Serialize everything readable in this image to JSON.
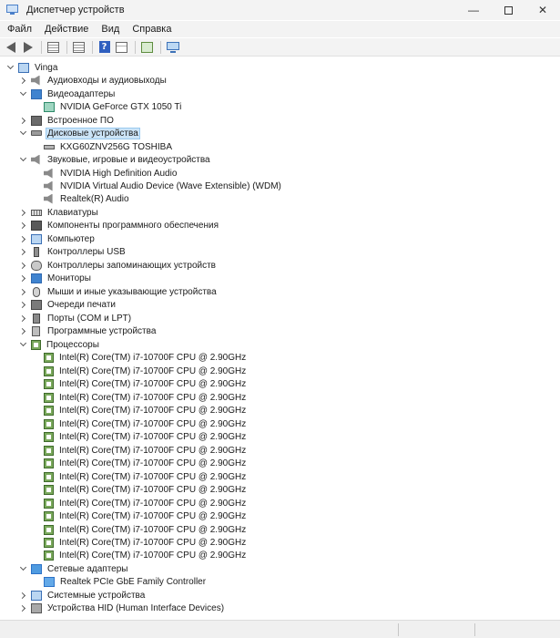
{
  "window": {
    "title": "Диспетчер устройств",
    "controls": {
      "minimize": "—",
      "maximize": "",
      "close": "✕"
    }
  },
  "menu": [
    "Файл",
    "Действие",
    "Вид",
    "Справка"
  ],
  "toolbar": {
    "buttons": [
      "back-icon",
      "forward-icon",
      "view-icon",
      "list-icon",
      "help-icon",
      "properties-icon",
      "scan-icon",
      "monitor-icon"
    ]
  },
  "tree": {
    "root": "Vinga",
    "categories": [
      {
        "label": "Аудиовходы и аудиовыходы",
        "icon": "audio-icon",
        "expanded": false
      },
      {
        "label": "Видеоадаптеры",
        "icon": "display-adapter-icon",
        "expanded": true,
        "children": [
          "NVIDIA GeForce GTX 1050 Ti"
        ]
      },
      {
        "label": "Встроенное ПО",
        "icon": "firmware-icon",
        "expanded": false
      },
      {
        "label": "Дисковые устройства",
        "icon": "disk-icon",
        "expanded": true,
        "selected": true,
        "children": [
          "KXG60ZNV256G TOSHIBA"
        ]
      },
      {
        "label": "Звуковые, игровые и видеоустройства",
        "icon": "sound-icon",
        "expanded": true,
        "children": [
          "NVIDIA High Definition Audio",
          "NVIDIA Virtual Audio Device (Wave Extensible) (WDM)",
          "Realtek(R) Audio"
        ]
      },
      {
        "label": "Клавиатуры",
        "icon": "keyboard-icon",
        "expanded": false
      },
      {
        "label": "Компоненты программного обеспечения",
        "icon": "software-component-icon",
        "expanded": false
      },
      {
        "label": "Компьютер",
        "icon": "computer-icon",
        "expanded": false
      },
      {
        "label": "Контроллеры USB",
        "icon": "usb-icon",
        "expanded": false
      },
      {
        "label": "Контроллеры запоминающих устройств",
        "icon": "storage-controller-icon",
        "expanded": false
      },
      {
        "label": "Мониторы",
        "icon": "monitor-icon",
        "expanded": false
      },
      {
        "label": "Мыши и иные указывающие устройства",
        "icon": "mouse-icon",
        "expanded": false
      },
      {
        "label": "Очереди печати",
        "icon": "printer-icon",
        "expanded": false
      },
      {
        "label": "Порты (COM и LPT)",
        "icon": "port-icon",
        "expanded": false
      },
      {
        "label": "Программные устройства",
        "icon": "software-device-icon",
        "expanded": false
      },
      {
        "label": "Процессоры",
        "icon": "processor-icon",
        "expanded": true,
        "children": [
          "Intel(R) Core(TM) i7-10700F CPU @ 2.90GHz",
          "Intel(R) Core(TM) i7-10700F CPU @ 2.90GHz",
          "Intel(R) Core(TM) i7-10700F CPU @ 2.90GHz",
          "Intel(R) Core(TM) i7-10700F CPU @ 2.90GHz",
          "Intel(R) Core(TM) i7-10700F CPU @ 2.90GHz",
          "Intel(R) Core(TM) i7-10700F CPU @ 2.90GHz",
          "Intel(R) Core(TM) i7-10700F CPU @ 2.90GHz",
          "Intel(R) Core(TM) i7-10700F CPU @ 2.90GHz",
          "Intel(R) Core(TM) i7-10700F CPU @ 2.90GHz",
          "Intel(R) Core(TM) i7-10700F CPU @ 2.90GHz",
          "Intel(R) Core(TM) i7-10700F CPU @ 2.90GHz",
          "Intel(R) Core(TM) i7-10700F CPU @ 2.90GHz",
          "Intel(R) Core(TM) i7-10700F CPU @ 2.90GHz",
          "Intel(R) Core(TM) i7-10700F CPU @ 2.90GHz",
          "Intel(R) Core(TM) i7-10700F CPU @ 2.90GHz",
          "Intel(R) Core(TM) i7-10700F CPU @ 2.90GHz"
        ]
      },
      {
        "label": "Сетевые адаптеры",
        "icon": "network-adapter-icon",
        "expanded": true,
        "children": [
          "Realtek PCIe GbE Family Controller"
        ]
      },
      {
        "label": "Системные устройства",
        "icon": "system-devices-icon",
        "expanded": false
      },
      {
        "label": "Устройства HID (Human Interface Devices)",
        "icon": "hid-icon",
        "expanded": false
      }
    ]
  }
}
